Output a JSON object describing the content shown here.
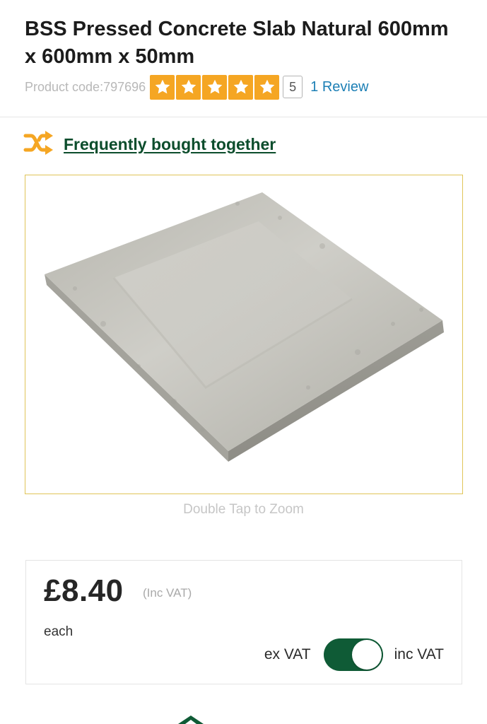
{
  "product": {
    "title": "BSS Pressed Concrete Slab Natural 600mm x 600mm x 50mm",
    "code_label": "Product code:797696",
    "rating": 5,
    "rating_display": "5",
    "review_link": "1 Review"
  },
  "fbt": {
    "label": "Frequently bought together",
    "icon": "shuffle-icon"
  },
  "image": {
    "zoom_hint": "Double Tap to Zoom"
  },
  "pricing": {
    "price": "£8.40",
    "vat_note": "(Inc VAT)",
    "unit": "each",
    "toggle_left_label": "ex VAT",
    "toggle_right_label": "inc VAT",
    "toggle_state": "inc VAT"
  },
  "colors": {
    "star": "#f5a623",
    "brand_green": "#0f5b36",
    "link_blue": "#1c7fb5",
    "frame_border": "#e0c458"
  }
}
